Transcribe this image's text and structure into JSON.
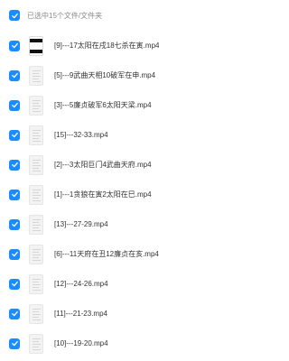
{
  "header": {
    "label": "已选中15个文件/文件夹"
  },
  "files": [
    {
      "name": "[9]---17太阳在戌18七杀在寅.mp4",
      "thumb": "video"
    },
    {
      "name": "[5]---9武曲天相10破军在申.mp4",
      "thumb": "doc"
    },
    {
      "name": "[3]---5廉贞破军6太阳天梁.mp4",
      "thumb": "doc"
    },
    {
      "name": "[15]---32-33.mp4",
      "thumb": "doc"
    },
    {
      "name": "[2]---3太阳巨门4武曲天府.mp4",
      "thumb": "doc"
    },
    {
      "name": "[1]---1贪狼在寅2太阳在巳.mp4",
      "thumb": "doc"
    },
    {
      "name": "[13]---27-29.mp4",
      "thumb": "doc"
    },
    {
      "name": "[6]---11天府在丑12廉贞在亥.mp4",
      "thumb": "doc"
    },
    {
      "name": "[12]---24-26.mp4",
      "thumb": "doc"
    },
    {
      "name": "[11]---21-23.mp4",
      "thumb": "doc"
    },
    {
      "name": "[10]---19-20.mp4",
      "thumb": "doc"
    }
  ],
  "colors": {
    "accent": "#1a8cff",
    "text": "#333333",
    "muted": "#8a8a8a"
  },
  "icons": {
    "checkbox": "checkmark-icon"
  }
}
